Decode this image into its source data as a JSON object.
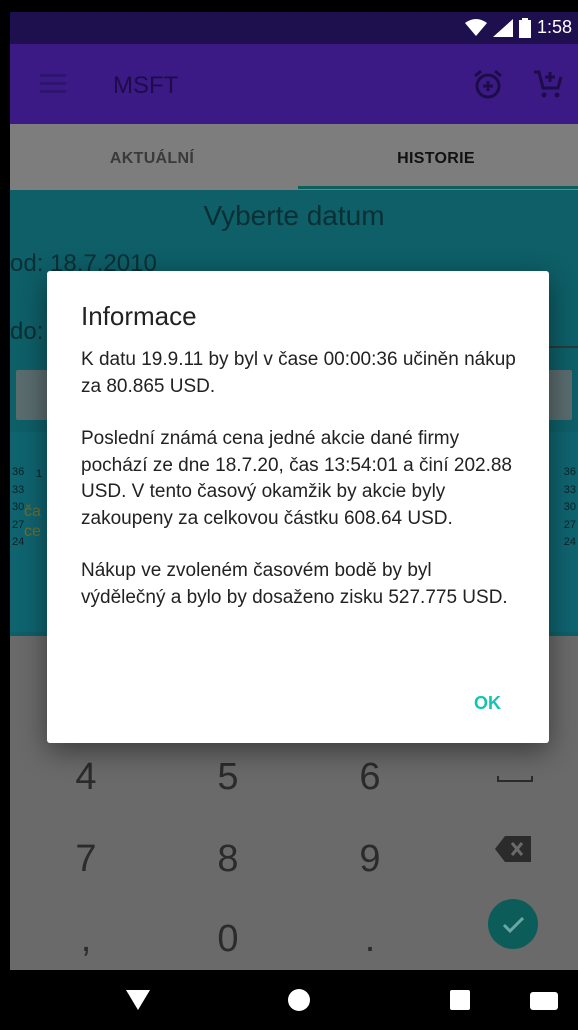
{
  "status_bar": {
    "time": "1:58"
  },
  "app_bar": {
    "title": "MSFT"
  },
  "tabs": [
    {
      "label": "AKTUÁLNÍ"
    },
    {
      "label": "HISTORIE"
    }
  ],
  "history": {
    "choose_date": "Vyberte datum",
    "od_label": "od: 18.7.2010",
    "do_label": "do:",
    "chart_hint_1": "ča",
    "chart_hint_2": "ce",
    "axis_top": "1",
    "y_axis_left": [
      "36",
      "33",
      "30",
      "27",
      "24"
    ],
    "y_axis_right": [
      "36",
      "33",
      "30",
      "27",
      "24"
    ]
  },
  "keyboard": {
    "keys": [
      "4",
      "5",
      "6",
      "7",
      "8",
      "9",
      ",",
      "0",
      "."
    ]
  },
  "dialog": {
    "title": "Informace",
    "paragraph_1": "K datu 19.9.11 by byl v čase 00:00:36 učiněn nákup za 80.865 USD.",
    "paragraph_2": "Poslední známá cena jedné akcie dané firmy pochází ze dne 18.7.20, čas 13:54:01 a činí 202.88 USD. V tento časový okamžik by akcie byly zakoupeny za celkovou částku 608.64 USD.",
    "paragraph_3": "Nákup ve zvoleném časovém bodě by byl výdělečný a bylo by dosaženo zisku 527.775 USD.",
    "ok_label": "OK"
  },
  "colors": {
    "app_bar": "#3b1a86",
    "accent": "#14c4b3",
    "teal_section": "#0e5f68"
  },
  "icons": {
    "menu": "menu-icon",
    "alarm_add": "alarm-add-icon",
    "cart_add": "add-shopping-cart-icon",
    "wifi": "wifi-icon",
    "signal": "signal-icon",
    "battery": "battery-icon",
    "backspace": "backspace-icon",
    "check": "check-icon"
  }
}
